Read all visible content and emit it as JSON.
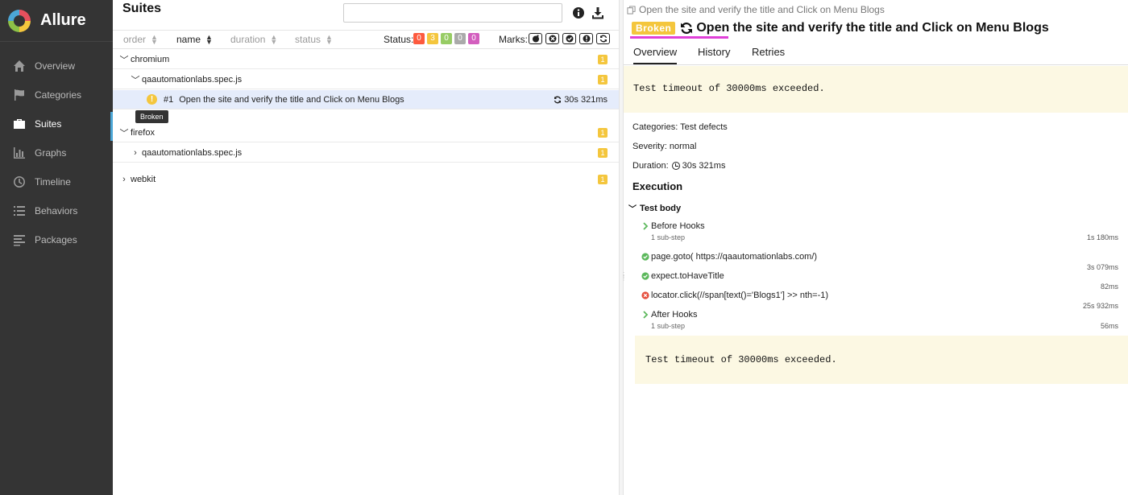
{
  "app": {
    "name": "Allure"
  },
  "sidebar": {
    "items": [
      {
        "label": "Overview",
        "icon": "home-icon"
      },
      {
        "label": "Categories",
        "icon": "flag-icon"
      },
      {
        "label": "Suites",
        "icon": "briefcase-icon",
        "active": true
      },
      {
        "label": "Graphs",
        "icon": "bar-chart-icon"
      },
      {
        "label": "Timeline",
        "icon": "clock-icon"
      },
      {
        "label": "Behaviors",
        "icon": "list-icon"
      },
      {
        "label": "Packages",
        "icon": "align-left-icon"
      }
    ]
  },
  "suites": {
    "title": "Suites",
    "search": {
      "value": "",
      "placeholder": ""
    },
    "sort": {
      "order": "order",
      "name": "name",
      "duration": "duration",
      "status": "status"
    },
    "status_label": "Status:",
    "status_counts": [
      {
        "value": "0",
        "color": "#fd5a3e"
      },
      {
        "value": "3",
        "color": "#f4c63d"
      },
      {
        "value": "0",
        "color": "#97cc64"
      },
      {
        "value": "0",
        "color": "#aaaaaa"
      },
      {
        "value": "0",
        "color": "#d35ebe"
      }
    ],
    "marks_label": "Marks:",
    "tree": {
      "chromium": {
        "label": "chromium",
        "count": "1"
      },
      "chromium_file": {
        "label": "qaautomationlabs.spec.js",
        "count": "1"
      },
      "test": {
        "num": "#1",
        "name": "Open the site and verify the title and Click on Menu Blogs",
        "duration": "30s 321ms",
        "status_icon": "!",
        "tooltip": "Broken"
      },
      "firefox": {
        "label": "firefox",
        "count": "1"
      },
      "firefox_file": {
        "label": "qaautomationlabs.spec.js",
        "count": "1"
      },
      "webkit": {
        "label": "webkit",
        "count": "1"
      }
    }
  },
  "detail": {
    "breadcrumb": "Open the site and verify the title and Click on Menu Blogs",
    "status_badge": "Broken",
    "title": "Open the site and verify the title and Click on Menu Blogs",
    "tabs": [
      "Overview",
      "History",
      "Retries"
    ],
    "message": "Test timeout of 30000ms exceeded.",
    "categories": "Categories: Test defects",
    "severity": "Severity: normal",
    "duration_label": "Duration:",
    "duration_value": "30s 321ms",
    "execution_title": "Execution",
    "test_body_title": "Test body",
    "steps": [
      {
        "name": "Before Hooks",
        "sub": "1 sub-step",
        "duration": "1s 180ms",
        "icon": "chevron-right-icon"
      },
      {
        "name": "page.goto( https://qaautomationlabs.com/)",
        "duration": "3s 079ms",
        "icon": "check-circle-icon"
      },
      {
        "name": "expect.toHaveTitle",
        "duration": "82ms",
        "icon": "check-circle-icon"
      },
      {
        "name": "locator.click(//span[text()='Blogs1'] >> nth=-1)",
        "duration": "25s 932ms",
        "icon": "x-circle-icon"
      },
      {
        "name": "After Hooks",
        "sub": "1 sub-step",
        "duration": "56ms",
        "icon": "chevron-right-icon"
      }
    ],
    "message_bottom": "Test timeout of 30000ms exceeded."
  }
}
